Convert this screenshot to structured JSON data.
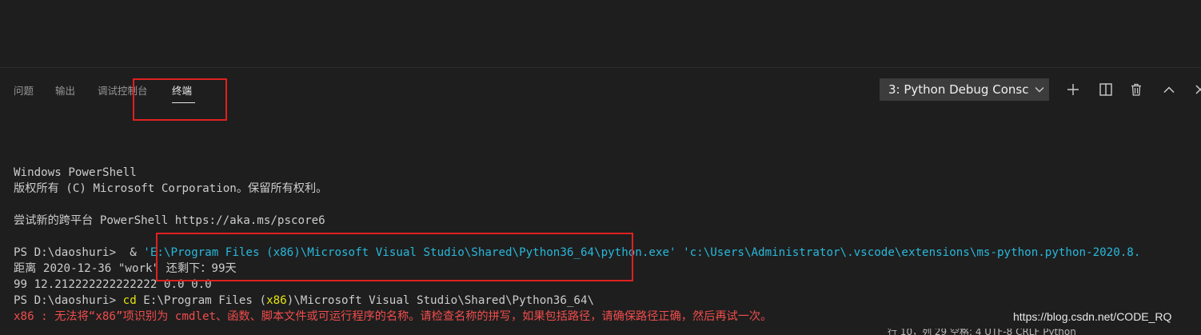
{
  "panel": {
    "tabs": [
      {
        "label": "问题",
        "active": false
      },
      {
        "label": "输出",
        "active": false
      },
      {
        "label": "调试控制台",
        "active": false
      },
      {
        "label": "终端",
        "active": true
      }
    ],
    "terminal_selector": {
      "selected": "3: Python Debug Consc"
    },
    "toolbar_icons": [
      "plus-icon",
      "split-icon",
      "trash-icon",
      "chevron-up-icon",
      "close-icon"
    ]
  },
  "terminal": {
    "lines": [
      [
        {
          "text": "Windows PowerShell"
        }
      ],
      [
        {
          "text": "版权所有 (C) Microsoft Corporation。保留所有权利。"
        }
      ],
      [
        {
          "text": ""
        }
      ],
      [
        {
          "text": "尝试新的跨平台 PowerShell https://aka.ms/pscore6"
        }
      ],
      [
        {
          "text": ""
        }
      ],
      [
        {
          "text": "PS D:\\daoshuri>  & "
        },
        {
          "text": "'E:\\Program Files (x86)\\Microsoft Visual Studio\\Shared\\Python36_64\\python.exe' 'c:\\Users\\Administrator\\.vscode\\extensions\\ms-python.python-2020.8.",
          "color": "cyan"
        }
      ],
      [
        {
          "text": "距离 2020-12-36 \"work\" 还剩下：99天"
        }
      ],
      [
        {
          "text": "99 12.212222222222222 0.0 0.0"
        }
      ],
      [
        {
          "text": "PS D:\\daoshuri> "
        },
        {
          "text": "cd",
          "color": "yellow"
        },
        {
          "text": " E:\\Program Files ("
        },
        {
          "text": "x86",
          "color": "yellow"
        },
        {
          "text": ")\\Microsoft Visual Studio\\Shared\\Python36_64\\"
        }
      ],
      [
        {
          "text": "x86 : 无法将“x86”项识别为 cmdlet、函数、脚本文件或可运行程序的名称。请检查名称的拼写，如果包括路径，请确保路径正确，然后再试一次。",
          "color": "red"
        }
      ]
    ]
  },
  "watermark": "https://blog.csdn.net/CODE_RQ",
  "status_bar_partial": "行 10，列 29   空格: 4   UTF-8   CRLF   Python",
  "colors": {
    "background": "#1e1e1e",
    "highlight_box": "#e02020",
    "ansi_cyan": "#29b8db",
    "ansi_yellow": "#e5e510",
    "ansi_red": "#f14c4c"
  }
}
